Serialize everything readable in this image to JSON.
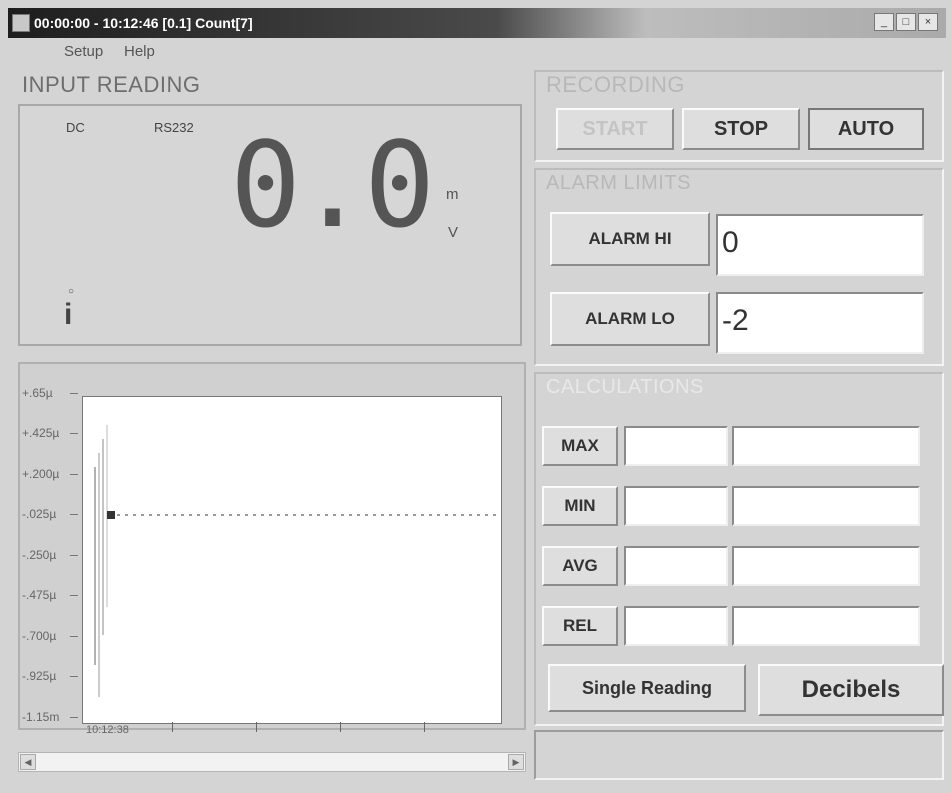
{
  "window": {
    "title": "00:00:00 - 10:12:46   [0.1]   Count[7]",
    "minimize_glyph": "_",
    "maximize_glyph": "□",
    "close_glyph": "×"
  },
  "menu": {
    "items": [
      "Setup",
      "Help"
    ]
  },
  "input_reading": {
    "title": "INPUT READING",
    "annunciators": {
      "dc": "DC",
      "rs232": "RS232",
      "hold": "i",
      "small": "○"
    },
    "value": "0.0",
    "unit_prefix": "m",
    "unit": "V"
  },
  "graph": {
    "y_ticks": [
      "+.65µ",
      "+.425µ",
      "+.200µ",
      "-.025µ",
      "-.250µ",
      "-.475µ",
      "-.700µ",
      "-.925µ",
      "-1.15m"
    ],
    "x_label": "10:12:38"
  },
  "recording": {
    "title": "RECORDING",
    "start_label": "START",
    "stop_label": "STOP",
    "auto_label": "AUTO"
  },
  "alarm_limits": {
    "title": "ALARM LIMITS",
    "hi_label": "ALARM HI",
    "hi_value": "0",
    "lo_label": "ALARM LO",
    "lo_value": "-2"
  },
  "calculations": {
    "title": "CALCULATIONS",
    "max_label": "MAX",
    "min_label": "MIN",
    "avg_label": "AVG",
    "rel_label": "REL"
  },
  "footer": {
    "single_reading_label": "Single Reading",
    "decibels_label": "Decibels"
  }
}
